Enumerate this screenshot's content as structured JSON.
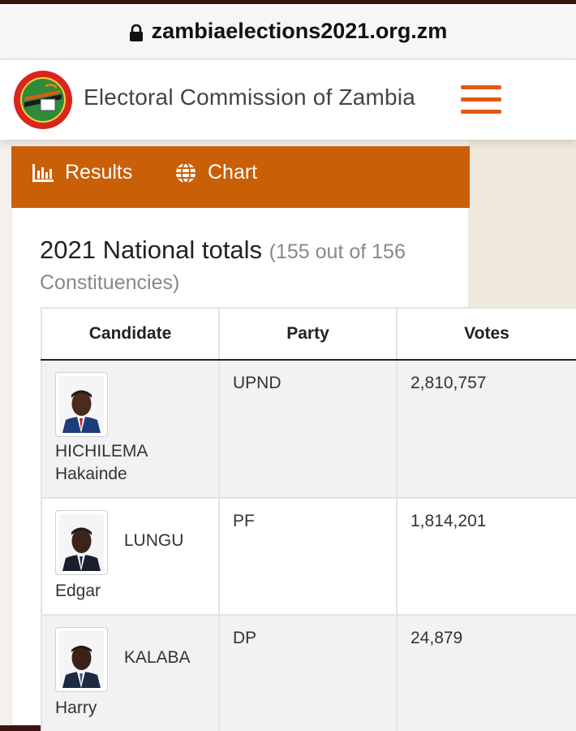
{
  "browser": {
    "url": "zambiaelections2021.org.zm"
  },
  "header": {
    "org_name": "Electoral Commission of Zambia",
    "logo_icon": "ecz-seal-logo",
    "menu_icon": "hamburger-menu-icon",
    "accent_color": "#e05a10"
  },
  "tabs": [
    {
      "label": "Results",
      "icon": "bar-chart-icon"
    },
    {
      "label": "Chart",
      "icon": "globe-icon"
    }
  ],
  "tab_bar_color": "#c95f06",
  "section": {
    "title": "2021 National totals",
    "subtitle": "(155 out of 156 Constituencies)"
  },
  "table": {
    "headers": [
      "Candidate",
      "Party",
      "Votes"
    ],
    "rows": [
      {
        "surname": "HICHILEMA",
        "given": "Hakainde",
        "party": "UPND",
        "votes": "2,810,757"
      },
      {
        "surname": "LUNGU",
        "given": "Edgar",
        "party": "PF",
        "votes": "1,814,201"
      },
      {
        "surname": "KALABA",
        "given": "Harry",
        "party": "DP",
        "votes": "24,879"
      }
    ]
  }
}
